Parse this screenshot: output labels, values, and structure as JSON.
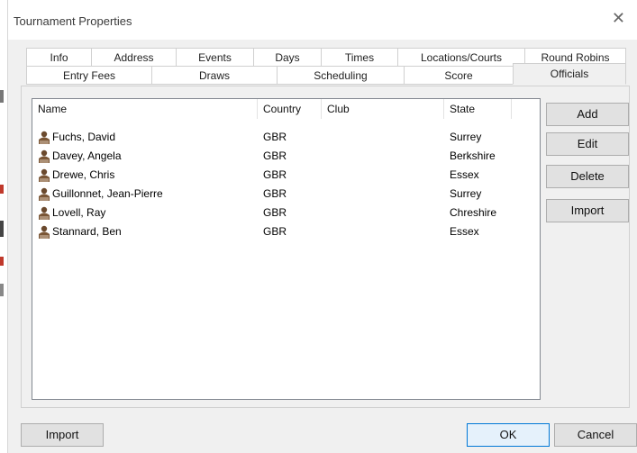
{
  "window": {
    "title": "Tournament Properties",
    "close_glyph": "✕"
  },
  "tabs_row1": [
    {
      "label": "Info"
    },
    {
      "label": "Address"
    },
    {
      "label": "Events"
    },
    {
      "label": "Days"
    },
    {
      "label": "Times"
    },
    {
      "label": "Locations/Courts"
    },
    {
      "label": "Round Robins"
    }
  ],
  "tabs_row2": [
    {
      "label": "Entry Fees"
    },
    {
      "label": "Draws"
    },
    {
      "label": "Scheduling"
    },
    {
      "label": "Score"
    },
    {
      "label": "Officials",
      "selected": true
    }
  ],
  "officials_list": {
    "columns": [
      "Name",
      "Country",
      "Club",
      "State"
    ],
    "rows": [
      {
        "name": "Fuchs, David",
        "country": "GBR",
        "club": "",
        "state": "Surrey"
      },
      {
        "name": "Davey, Angela",
        "country": "GBR",
        "club": "",
        "state": "Berkshire"
      },
      {
        "name": "Drewe, Chris",
        "country": "GBR",
        "club": "",
        "state": "Essex"
      },
      {
        "name": "Guillonnet, Jean-Pierre",
        "country": "GBR",
        "club": "",
        "state": "Surrey"
      },
      {
        "name": "Lovell, Ray",
        "country": "GBR",
        "club": "",
        "state": "Chreshire"
      },
      {
        "name": "Stannard, Ben",
        "country": "GBR",
        "club": "",
        "state": "Essex"
      }
    ],
    "row_icon": "person-icon"
  },
  "side_buttons": {
    "add": "Add",
    "edit": "Edit",
    "delete": "Delete",
    "import": "Import"
  },
  "footer_buttons": {
    "import": "Import",
    "ok": "OK",
    "cancel": "Cancel"
  },
  "colors": {
    "dialog_bg": "#f0f0f0",
    "default_button_border": "#0078d7",
    "list_border": "#828790"
  }
}
